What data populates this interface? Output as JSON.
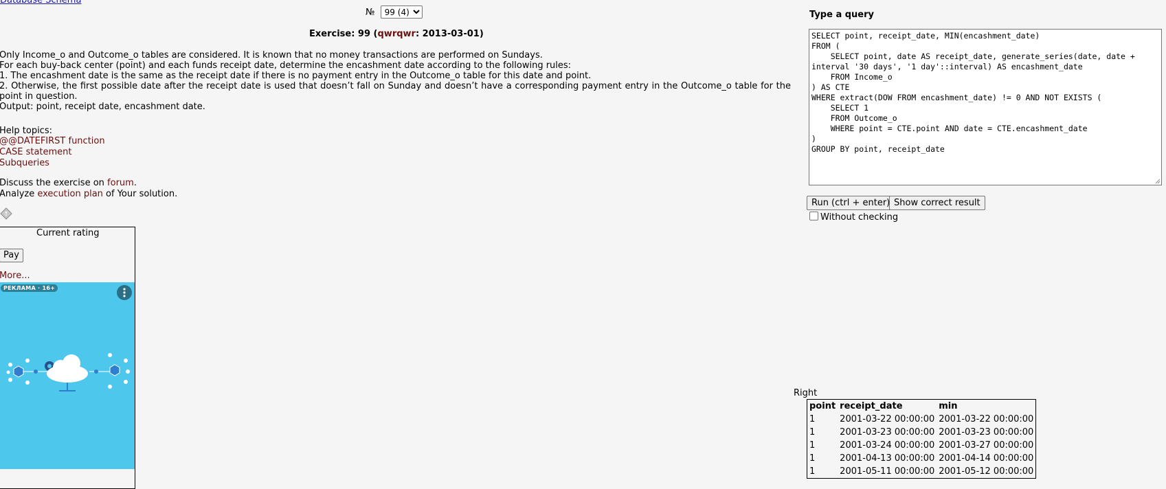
{
  "top_link": "Database Schema",
  "exercise_selector": {
    "prefix": "№",
    "selected": "99 (4)"
  },
  "exercise": {
    "title_prefix": "Exercise: 99 (",
    "author": "qwrqwr",
    "title_suffix": ": 2013-03-01)"
  },
  "description": [
    "Only Income_o and Outcome_o tables are considered. It is known that no money transactions are performed on Sundays.",
    "For each buy-back center (point) and each funds receipt date, determine the encashment date according to the following rules:",
    "1. The encashment date is the same as the receipt date if there is no payment entry in the Outcome_o table for this date and point.",
    "2. Otherwise, the first possible date after the receipt date is used that doesn’t fall on Sunday and doesn’t have a corresponding payment entry in the Outcome_o table for the point in question.",
    "Output: point, receipt date, encashment date."
  ],
  "help": {
    "title": "Help topics:",
    "links": [
      "@@DATEFIRST function",
      "CASE statement",
      "Subqueries"
    ]
  },
  "discuss": {
    "prefix": "Discuss the exercise on ",
    "link": "forum",
    "suffix": "."
  },
  "analyze": {
    "prefix": "Analyze ",
    "link": "execution plan",
    "suffix": " of Your solution."
  },
  "rating": {
    "title": "Current rating",
    "pay_label": "Pay",
    "more_label": "More..."
  },
  "ad": {
    "badge": "РЕКЛАМА · 16+"
  },
  "query_panel": {
    "title": "Type a query",
    "query": "SELECT point, receipt_date, MIN(encashment_date)\nFROM (\n    SELECT point, date AS receipt_date, generate_series(date, date + interval '30 days', '1 day'::interval) AS encashment_date\n    FROM Income_o\n) AS CTE\nWHERE extract(DOW FROM encashment_date) != 0 AND NOT EXISTS (\n    SELECT 1\n    FROM Outcome_o\n    WHERE point = CTE.point AND date = CTE.encashment_date\n)\nGROUP BY point, receipt_date",
    "run_label": "Run (ctrl + enter)",
    "show_label": "Show correct result",
    "without_checking_label": "Without checking"
  },
  "result": {
    "label": "Right",
    "columns": [
      "point",
      "receipt_date",
      "min"
    ],
    "rows": [
      [
        "1",
        "2001-03-22 00:00:00",
        "2001-03-22 00:00:00"
      ],
      [
        "1",
        "2001-03-23 00:00:00",
        "2001-03-23 00:00:00"
      ],
      [
        "1",
        "2001-03-24 00:00:00",
        "2001-03-27 00:00:00"
      ],
      [
        "1",
        "2001-04-13 00:00:00",
        "2001-04-14 00:00:00"
      ],
      [
        "1",
        "2001-05-11 00:00:00",
        "2001-05-12 00:00:00"
      ]
    ]
  },
  "colors": {
    "background": "#f5f5f5",
    "link": "#6b0f0f",
    "ad_background": "#4dc7ec"
  }
}
